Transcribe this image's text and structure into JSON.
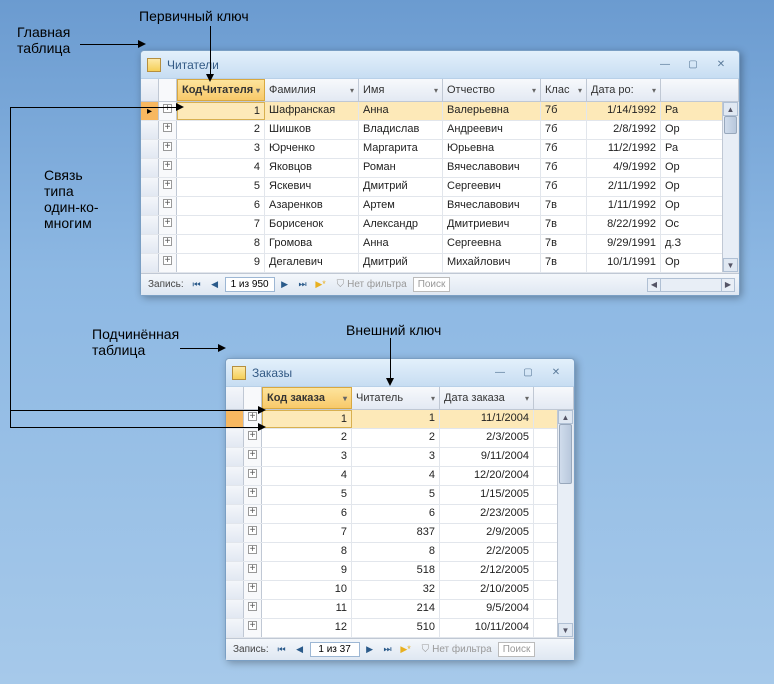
{
  "annotations": {
    "main_table": "Главная\nтаблица",
    "primary_key": "Первичный ключ",
    "relation": "Связь\nтипа\nодин-ко-\nмногим",
    "sub_table": "Подчинённая\nтаблица",
    "foreign_key": "Внешний ключ"
  },
  "window1": {
    "title": "Читатели",
    "columns": {
      "id": "КодЧитателя",
      "lname": "Фамилия",
      "fname": "Имя",
      "mname": "Отчество",
      "class": "Клас",
      "dob": "Дата ро:"
    },
    "rows": [
      {
        "id": "1",
        "lname": "Шафранская",
        "fname": "Анна",
        "mname": "Валерьевна",
        "class": "7б",
        "dob": "1/14/1992",
        "x": "Ра"
      },
      {
        "id": "2",
        "lname": "Шишков",
        "fname": "Владислав",
        "mname": "Андреевич",
        "class": "7б",
        "dob": "2/8/1992",
        "x": "Ор"
      },
      {
        "id": "3",
        "lname": "Юрченко",
        "fname": "Маргарита",
        "mname": "Юрьевна",
        "class": "7б",
        "dob": "11/2/1992",
        "x": "Ра"
      },
      {
        "id": "4",
        "lname": "Яковцов",
        "fname": "Роман",
        "mname": "Вячеславович",
        "class": "7б",
        "dob": "4/9/1992",
        "x": "Ор"
      },
      {
        "id": "5",
        "lname": "Яскевич",
        "fname": "Дмитрий",
        "mname": "Сергеевич",
        "class": "7б",
        "dob": "2/11/1992",
        "x": "Ор"
      },
      {
        "id": "6",
        "lname": "Азаренков",
        "fname": "Артем",
        "mname": "Вячеславович",
        "class": "7в",
        "dob": "1/11/1992",
        "x": "Ор"
      },
      {
        "id": "7",
        "lname": "Борисенок",
        "fname": "Александр",
        "mname": "Дмитриевич",
        "class": "7в",
        "dob": "8/22/1992",
        "x": "Ос"
      },
      {
        "id": "8",
        "lname": "Громова",
        "fname": "Анна",
        "mname": "Сергеевна",
        "class": "7в",
        "dob": "9/29/1991",
        "x": "д.З"
      },
      {
        "id": "9",
        "lname": "Дегалевич",
        "fname": "Дмитрий",
        "mname": "Михайлович",
        "class": "7в",
        "dob": "10/1/1991",
        "x": "Ор"
      }
    ],
    "nav": {
      "label": "Запись:",
      "pos": "1 из 950",
      "nofilter": "Нет фильтра",
      "search": "Поиск"
    }
  },
  "window2": {
    "title": "Заказы",
    "columns": {
      "id": "Код заказа",
      "reader": "Читатель",
      "date": "Дата заказа"
    },
    "rows": [
      {
        "id": "1",
        "reader": "1",
        "date": "11/1/2004"
      },
      {
        "id": "2",
        "reader": "2",
        "date": "2/3/2005"
      },
      {
        "id": "3",
        "reader": "3",
        "date": "9/11/2004"
      },
      {
        "id": "4",
        "reader": "4",
        "date": "12/20/2004"
      },
      {
        "id": "5",
        "reader": "5",
        "date": "1/15/2005"
      },
      {
        "id": "6",
        "reader": "6",
        "date": "2/23/2005"
      },
      {
        "id": "7",
        "reader": "837",
        "date": "2/9/2005"
      },
      {
        "id": "8",
        "reader": "8",
        "date": "2/2/2005"
      },
      {
        "id": "9",
        "reader": "518",
        "date": "2/12/2005"
      },
      {
        "id": "10",
        "reader": "32",
        "date": "2/10/2005"
      },
      {
        "id": "11",
        "reader": "214",
        "date": "9/5/2004"
      },
      {
        "id": "12",
        "reader": "510",
        "date": "10/11/2004"
      }
    ],
    "nav": {
      "label": "Запись:",
      "pos": "1 из 37",
      "nofilter": "Нет фильтра",
      "search": "Поиск"
    }
  }
}
